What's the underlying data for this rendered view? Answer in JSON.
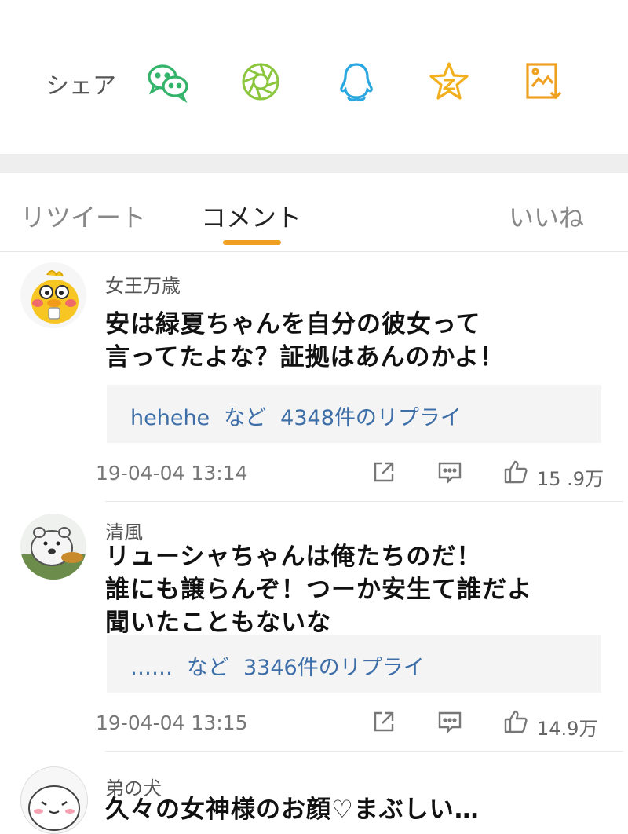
{
  "share": {
    "label": "シェア",
    "icons": [
      "wechat-icon",
      "moments-icon",
      "qq-icon",
      "qzone-icon",
      "save-image-icon"
    ],
    "colors": {
      "wechat": "#34b36b",
      "moments": "#8cc63e",
      "qq": "#2aa7e0",
      "qzone": "#f2b01e",
      "save": "#f0a020"
    }
  },
  "tabs": {
    "items": [
      "リツイート",
      "コメント",
      "いいね"
    ],
    "active": "コメント",
    "accent": "#f0a020"
  },
  "comments": [
    {
      "user": "女王万歳",
      "text": "安は緑夏ちゃんを自分の彼女って\n言ってたよな？証拠はあんのかよ！",
      "reply_user": "hehehe",
      "reply_connector": "など",
      "reply_count": "4348件のリプライ",
      "time": "19-04-04  13:14",
      "likes": "15 .9万"
    },
    {
      "user": "清風",
      "text": "リューシャちゃんは俺たちのだ！\n誰にも譲らんぞ！つーか安生て誰だよ\n聞いたこともないな",
      "reply_user": "……",
      "reply_connector": "など",
      "reply_count": "3346件のリプライ",
      "time": "19-04-04  13:15",
      "likes": "14.9万"
    },
    {
      "user": "弟の犬",
      "text": "久々の女神様のお顔♡まぶしい…"
    }
  ]
}
